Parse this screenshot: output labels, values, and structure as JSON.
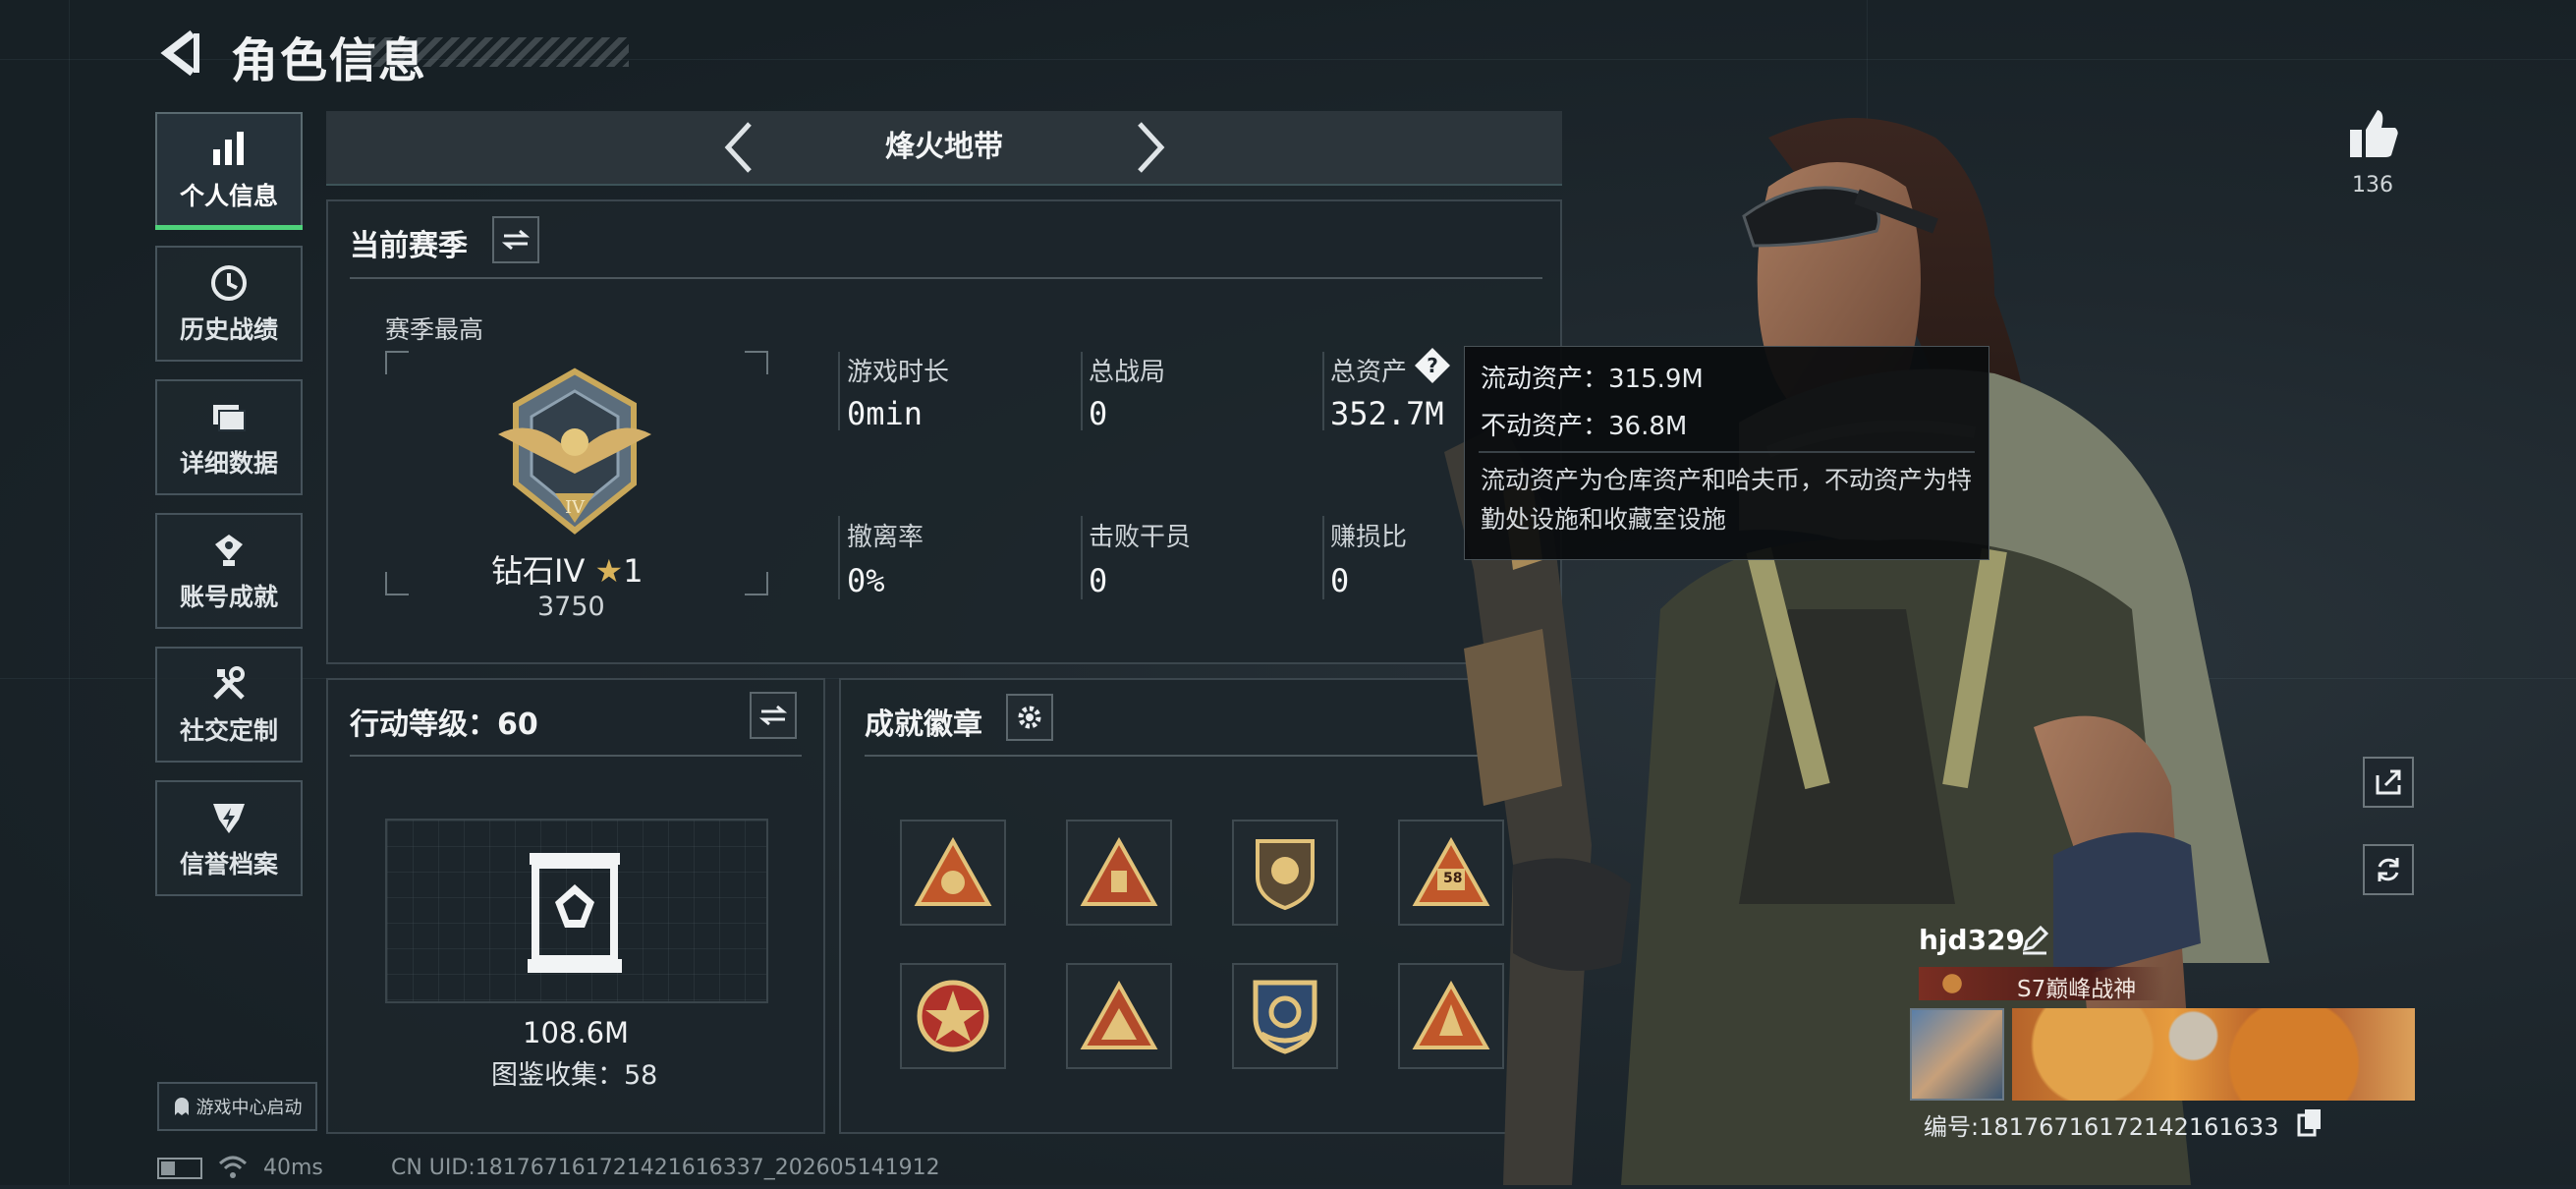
{
  "header": {
    "title": "角色信息"
  },
  "nav": {
    "items": [
      {
        "label": "个人信息",
        "icon": "bar-chart-icon",
        "active": true
      },
      {
        "label": "历史战绩",
        "icon": "history-clock-icon",
        "active": false
      },
      {
        "label": "详细数据",
        "icon": "folder-icon",
        "active": false
      },
      {
        "label": "账号成就",
        "icon": "achievement-icon",
        "active": false
      },
      {
        "label": "社交定制",
        "icon": "tools-icon",
        "active": false
      },
      {
        "label": "信誉档案",
        "icon": "shield-icon",
        "active": false
      }
    ],
    "game_center": "游戏中心启动"
  },
  "mode": {
    "title": "烽火地带"
  },
  "season": {
    "title": "当前赛季",
    "best_label": "赛季最高",
    "rank": "钻石IV",
    "stars": "1",
    "score": "3750",
    "stats": [
      {
        "label": "游戏时长",
        "value": "0min"
      },
      {
        "label": "总战局",
        "value": "0"
      },
      {
        "label": "总资产",
        "value": "352.7M"
      },
      {
        "label": "撤离率",
        "value": "0%"
      },
      {
        "label": "击败干员",
        "value": "0"
      },
      {
        "label": "赚损比",
        "value": "0"
      }
    ]
  },
  "tooltip": {
    "liquid": "流动资产：315.9M",
    "fixed": "不动资产：36.8M",
    "note": "流动资产为仓库资产和哈夫币，不动资产为特勤处设施和收藏室设施"
  },
  "level": {
    "title": "行动等级：60",
    "value": "108.6M",
    "collection": "图鉴收集：58"
  },
  "badges": {
    "title": "成就徽章",
    "count_badge": "58"
  },
  "profile": {
    "likes": "136",
    "name": "hjd329",
    "title_tag": "S7巅峰战神",
    "uid": "编号:18176716172142161633"
  },
  "footer": {
    "ping": "40ms",
    "cn_uid": "CN UID:181767161721421616337_202605141912"
  },
  "colors": {
    "accent_green": "#4ed27a",
    "tooltip_bg": "#0a0c0e",
    "title_tag": "#7a2e22"
  }
}
